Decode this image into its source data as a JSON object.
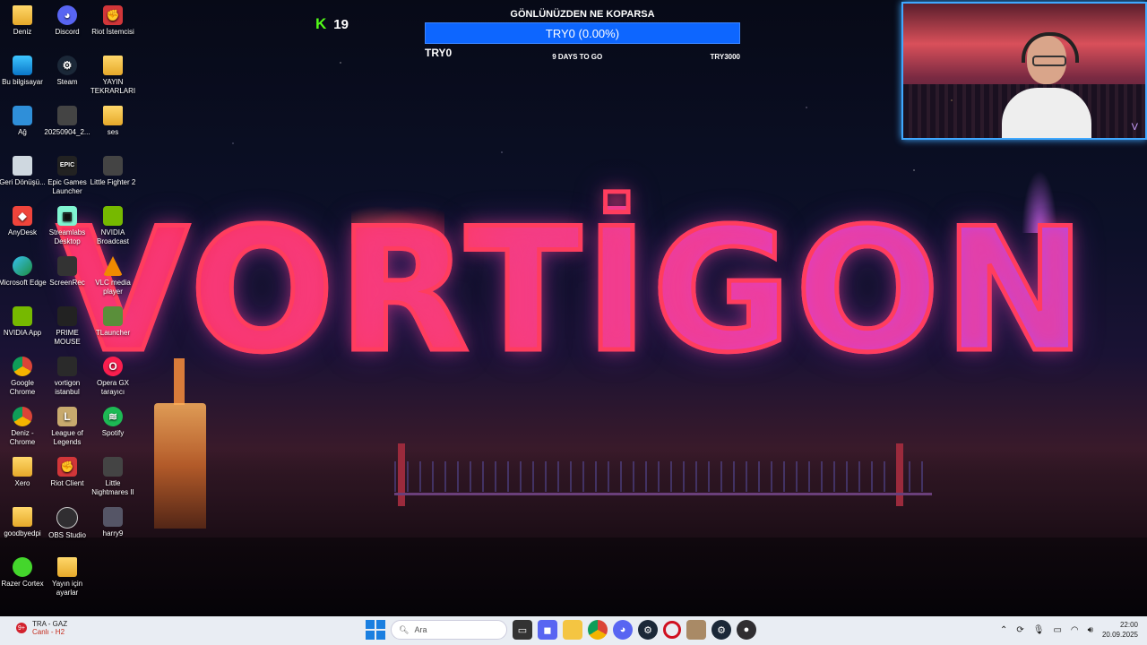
{
  "desktop_icons": [
    {
      "label": "Deniz",
      "icon": "folder-icon"
    },
    {
      "label": "Discord",
      "icon": "discord-icon"
    },
    {
      "label": "Riot İstemcisi",
      "icon": "riot-icon"
    },
    {
      "label": "Bu bilgisayar",
      "icon": "computer-icon"
    },
    {
      "label": "Steam",
      "icon": "steam-icon"
    },
    {
      "label": "YAYIN TEKRARLARI",
      "icon": "folder-icon"
    },
    {
      "label": "Ağ",
      "icon": "network-icon"
    },
    {
      "label": "20250904_2...",
      "icon": "file-icon"
    },
    {
      "label": "ses",
      "icon": "folder-icon"
    },
    {
      "label": "Geri Dönüşü...",
      "icon": "recycle-bin-icon"
    },
    {
      "label": "Epic Games Launcher",
      "icon": "epic-games-icon"
    },
    {
      "label": "Little Fighter 2",
      "icon": "little-fighter-icon"
    },
    {
      "label": "AnyDesk",
      "icon": "anydesk-icon"
    },
    {
      "label": "Streamlabs Desktop",
      "icon": "streamlabs-icon"
    },
    {
      "label": "NVIDIA Broadcast",
      "icon": "nvidia-broadcast-icon"
    },
    {
      "label": "Microsoft Edge",
      "icon": "edge-icon"
    },
    {
      "label": "ScreenRec",
      "icon": "screenrec-icon"
    },
    {
      "label": "VLC media player",
      "icon": "vlc-icon"
    },
    {
      "label": "NVIDIA App",
      "icon": "nvidia-icon"
    },
    {
      "label": "PRIME MOUSE",
      "icon": "mouse-icon"
    },
    {
      "label": "TLauncher",
      "icon": "tlauncher-icon"
    },
    {
      "label": "Google Chrome",
      "icon": "chrome-icon"
    },
    {
      "label": "vortigon istanbul",
      "icon": "image-file-icon"
    },
    {
      "label": "Opera GX tarayıcı",
      "icon": "opera-gx-icon"
    },
    {
      "label": "Deniz - Chrome",
      "icon": "chrome-icon"
    },
    {
      "label": "League of Legends",
      "icon": "league-icon"
    },
    {
      "label": "Spotify",
      "icon": "spotify-icon"
    },
    {
      "label": "Xero",
      "icon": "folder-icon"
    },
    {
      "label": "Riot Client",
      "icon": "riot-icon"
    },
    {
      "label": "Little Nightmares II",
      "icon": "little-nightmares-icon"
    },
    {
      "label": "goodbyedpi",
      "icon": "folder-icon"
    },
    {
      "label": "OBS Studio",
      "icon": "obs-icon"
    },
    {
      "label": "harry9",
      "icon": "image-file-icon"
    },
    {
      "label": "Razer Cortex",
      "icon": "razer-icon"
    },
    {
      "label": "Yayın için ayarlar",
      "icon": "folder-icon"
    }
  ],
  "wallpaper": {
    "logo_text": "VORTİGON"
  },
  "kick": {
    "icon": "K",
    "count": "19",
    "color": "#53fc18"
  },
  "goal": {
    "title": "GÖNLÜNÜZDEN NE KOPARSA",
    "bar_text": "TRY0 (0.00%)",
    "progress": 0.0,
    "start": "TRY0",
    "days": "9 DAYS TO GO",
    "target": "TRY3000"
  },
  "webcam": {
    "watermark": "V"
  },
  "taskbar": {
    "weather_badge": "9+",
    "weather_title": "TRA - GAZ",
    "weather_sub": "Canlı - H2",
    "search_placeholder": "Ara",
    "tray_icons": [
      "chevron-up-icon",
      "sync-icon",
      "microphone-icon",
      "display-icon",
      "wifi-icon",
      "volume-icon"
    ],
    "time": "22:00",
    "date": "20.09.2025"
  },
  "colors": {
    "accent": "#0d66ff",
    "neon_red": "#ff3d5e",
    "neon_purple": "#b04af0",
    "taskbar": "#e9edf3"
  }
}
